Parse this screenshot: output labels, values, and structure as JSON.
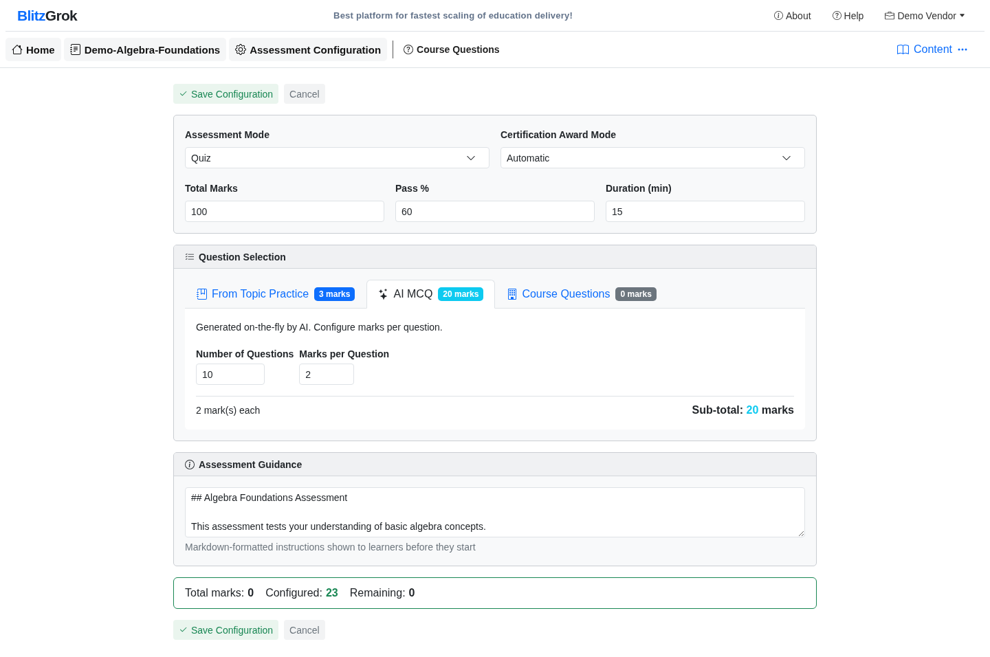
{
  "header": {
    "brand": {
      "start": "Blitz",
      "end": "Grok"
    },
    "tagline": "Best platform for fastest scaling of education delivery!",
    "links": [
      {
        "kind": "info",
        "label": "About"
      },
      {
        "kind": "help",
        "label": "Help"
      },
      {
        "kind": "account",
        "label": "Demo Vendor"
      }
    ]
  },
  "nav": {
    "breadcrumbs": [
      {
        "kind": "home",
        "label": "Home"
      },
      {
        "kind": "course",
        "label": "Demo-Algebra-Foundations"
      },
      {
        "kind": "settings",
        "label": "Assessment Configuration"
      }
    ],
    "links": [
      {
        "kind": "help",
        "label": "Course Questions"
      }
    ],
    "content_menu": {
      "label": "Content"
    }
  },
  "actions_top": [
    {
      "kind": "save",
      "label": "Save Configuration"
    },
    {
      "kind": "cancel",
      "label": "Cancel"
    }
  ],
  "settings": {
    "rows": [
      {
        "fields": [
          {
            "kind": "select",
            "label": "Assessment Mode",
            "value": "Quiz"
          },
          {
            "kind": "select",
            "label": "Certification Award Mode",
            "value": "Automatic"
          }
        ]
      },
      {
        "fields": [
          {
            "kind": "input",
            "label": "Total Marks",
            "value": "100"
          },
          {
            "kind": "input",
            "label": "Pass %",
            "value": "60"
          },
          {
            "kind": "input",
            "label": "Duration (min)",
            "value": "15"
          }
        ]
      }
    ]
  },
  "question_selection": {
    "title": "Question Selection",
    "tabs": [
      {
        "kind": "topic",
        "label": "From Topic Practice",
        "badge": "3 marks",
        "color": "#0d6efd",
        "selected": false
      },
      {
        "kind": "ai",
        "label": "AI MCQ",
        "badge": "20 marks",
        "color": "#0dcaf0",
        "selected": true
      },
      {
        "kind": "course",
        "label": "Course Questions",
        "badge": "0 marks",
        "color": "#6c757d",
        "selected": false
      }
    ],
    "panel": {
      "description": "Generated on-the-fly by AI. Configure marks per question.",
      "fields": [
        {
          "label": "Number of Questions",
          "value": "10"
        },
        {
          "label": "Marks per Question",
          "value": "2"
        }
      ],
      "note": "2 mark(s) each",
      "subtotal": {
        "label": "Sub-total:",
        "value": "20",
        "unit": "marks"
      }
    }
  },
  "guidance": {
    "title": "Assessment Guidance",
    "text": "## Algebra Foundations Assessment\n\nThis assessment tests your understanding of basic algebra concepts.",
    "help": "Markdown-formatted instructions shown to learners before they start"
  },
  "summary": [
    {
      "label": "Total marks:",
      "value": "0",
      "highlighted": false
    },
    {
      "label": "Configured:",
      "value": "23",
      "highlighted": true
    },
    {
      "label": "Remaining:",
      "value": "0",
      "highlighted": false
    }
  ],
  "actions_bottom": [
    {
      "kind": "save",
      "label": "Save Configuration"
    },
    {
      "kind": "cancel",
      "label": "Cancel"
    }
  ]
}
